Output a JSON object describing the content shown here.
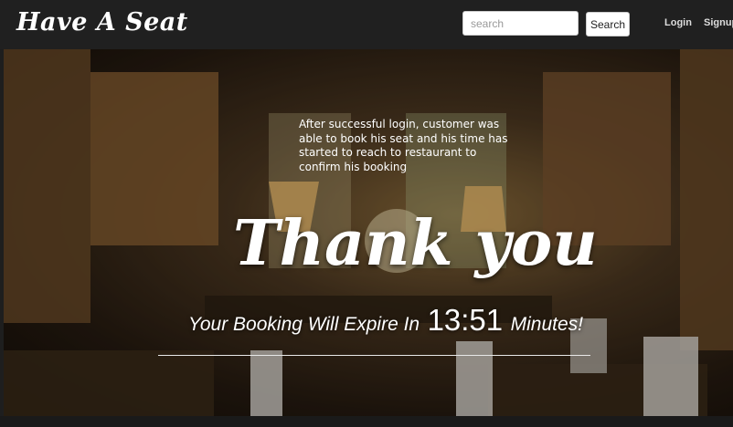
{
  "navbar": {
    "brand": "Have A Seat",
    "search_placeholder": "search",
    "search_button": "Search",
    "login": "Login",
    "signup": "Signup"
  },
  "hero": {
    "note": "After successful login, customer was able to book his seat and his time has started to reach to restaurant to confirm his booking",
    "heading": "Thank you",
    "expire_prefix": "Your Booking Will Expire In",
    "timer": "13:51",
    "expire_suffix": "Minutes!"
  },
  "colors": {
    "navbar_bg": "#202020",
    "text": "#ffffff"
  }
}
